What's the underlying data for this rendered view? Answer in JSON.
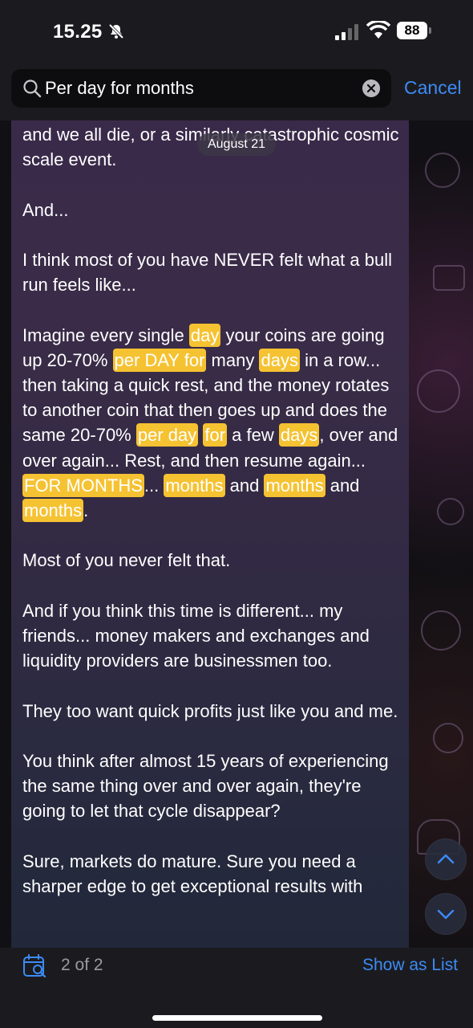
{
  "status": {
    "time": "15.25",
    "battery": "88"
  },
  "search": {
    "query": "Per day for months",
    "cancel": "Cancel"
  },
  "date_badge": "August 21",
  "message": {
    "p1": [
      {
        "t": "and we all die, or a similarly catastrophic"
      },
      {
        "t": " cosmic scale event."
      }
    ],
    "p2": [
      {
        "t": "And..."
      }
    ],
    "p3": [
      {
        "t": "I think most of you have NEVER felt what a bull run feels like..."
      }
    ],
    "p4": [
      {
        "t": "Imagine every single "
      },
      {
        "t": "day",
        "hl": true
      },
      {
        "t": " your coins are going up  20-70% "
      },
      {
        "t": "per DAY for",
        "hl": true
      },
      {
        "t": " many "
      },
      {
        "t": "days",
        "hl": true
      },
      {
        "t": " in a row... then taking a quick rest, and the money rotates to another coin that then goes up and does the same 20-70% "
      },
      {
        "t": "per day",
        "hl": true
      },
      {
        "t": " "
      },
      {
        "t": "for",
        "hl": true
      },
      {
        "t": " a few "
      },
      {
        "t": "days",
        "hl": true
      },
      {
        "t": ", over and over again... Rest, and then resume again... "
      },
      {
        "t": "FOR MONTHS",
        "hl": true
      },
      {
        "t": "... "
      },
      {
        "t": "months",
        "hl": true
      },
      {
        "t": " and "
      },
      {
        "t": "months",
        "hl": true
      },
      {
        "t": " and "
      },
      {
        "t": "months",
        "hl": true
      },
      {
        "t": "."
      }
    ],
    "p5": [
      {
        "t": "Most of you never felt that."
      }
    ],
    "p6": [
      {
        "t": "And if you think this time is different... my friends... money makers and exchanges and liquidity providers are businessmen too."
      }
    ],
    "p7": [
      {
        "t": "They too want quick profits just like you and me."
      }
    ],
    "p8": [
      {
        "t": "You think after almost 15 years of experiencing the same thing over and over again, they're going to let that cycle disappear?"
      }
    ],
    "p9": [
      {
        "t": "Sure, markets do mature. Sure you need a sharper edge to get exceptional results with"
      }
    ]
  },
  "toolbar": {
    "count": "2 of 2",
    "show_list": "Show as List"
  },
  "colors": {
    "accent": "#3d8bf5",
    "highlight": "#f5c232"
  },
  "icons": [
    "bell-slash-icon",
    "signal-icon",
    "wifi-icon",
    "battery-icon",
    "search-icon",
    "clear-icon",
    "calendar-search-icon",
    "chevron-up-icon",
    "chevron-down-icon"
  ]
}
